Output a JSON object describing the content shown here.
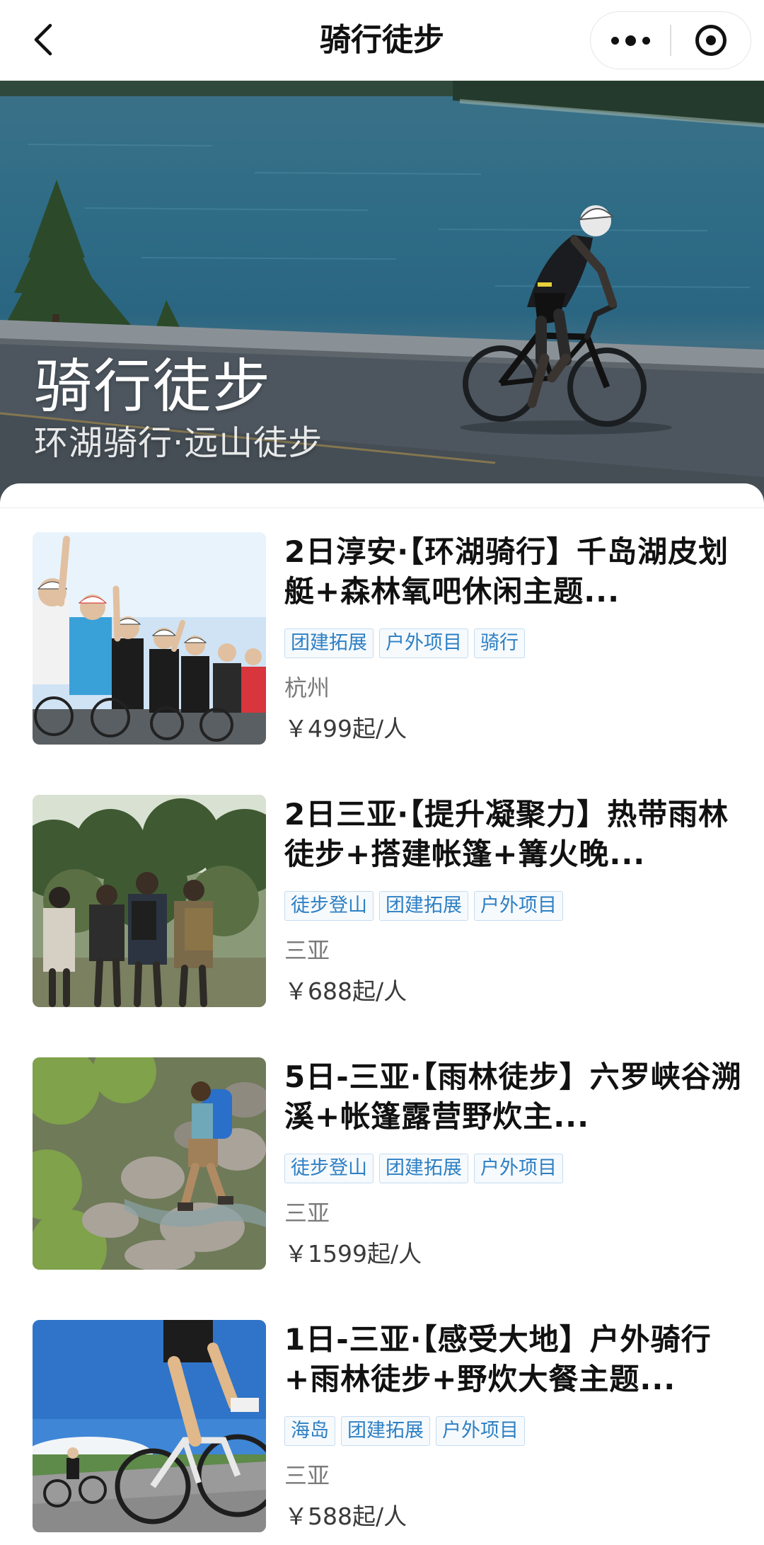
{
  "nav": {
    "title": "骑行徒步"
  },
  "banner": {
    "title": "骑行徒步",
    "subtitle": "环湖骑行·远山徒步"
  },
  "items": [
    {
      "title": "2日淳安·【环湖骑行】千岛湖皮划艇+森林氧吧休闲主题...",
      "tags": [
        "团建拓展",
        "户外项目",
        "骑行"
      ],
      "city": "杭州",
      "price": "￥499起/人"
    },
    {
      "title": "2日三亚·【提升凝聚力】热带雨林徒步+搭建帐篷+篝火晚...",
      "tags": [
        "徒步登山",
        "团建拓展",
        "户外项目"
      ],
      "city": "三亚",
      "price": "￥688起/人"
    },
    {
      "title": "5日-三亚·【雨林徒步】六罗峡谷溯溪+帐篷露营野炊主...",
      "tags": [
        "徒步登山",
        "团建拓展",
        "户外项目"
      ],
      "city": "三亚",
      "price": "￥1599起/人"
    },
    {
      "title": "1日-三亚·【感受大地】户外骑行+雨林徒步+野炊大餐主题...",
      "tags": [
        "海岛",
        "团建拓展",
        "户外项目"
      ],
      "city": "三亚",
      "price": "￥588起/人"
    }
  ]
}
